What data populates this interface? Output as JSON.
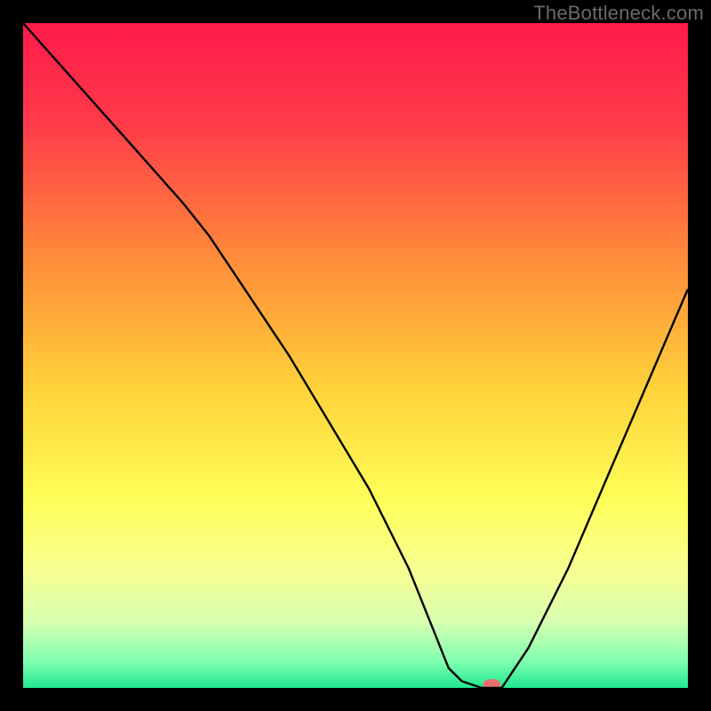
{
  "watermark": "TheBottleneck.com",
  "chart_data": {
    "type": "line",
    "title": "",
    "xlabel": "",
    "ylabel": "",
    "xlim": [
      0,
      100
    ],
    "ylim": [
      0,
      100
    ],
    "grid": false,
    "legend": false,
    "background_gradient": {
      "stops": [
        {
          "offset": 0.0,
          "color": "#ff1a4a"
        },
        {
          "offset": 0.15,
          "color": "#ff3a4a"
        },
        {
          "offset": 0.35,
          "color": "#ff8a3a"
        },
        {
          "offset": 0.55,
          "color": "#ffd23a"
        },
        {
          "offset": 0.72,
          "color": "#ffff5a"
        },
        {
          "offset": 0.82,
          "color": "#f8ff90"
        },
        {
          "offset": 0.9,
          "color": "#d8ffb0"
        },
        {
          "offset": 0.96,
          "color": "#80ffb0"
        },
        {
          "offset": 1.0,
          "color": "#20e890"
        }
      ]
    },
    "series": [
      {
        "name": "bottleneck-curve",
        "color": "#000000",
        "x": [
          0,
          8,
          16,
          24,
          28,
          34,
          40,
          46,
          52,
          58,
          62,
          64,
          66,
          69,
          72,
          76,
          82,
          88,
          94,
          100
        ],
        "y": [
          100,
          91,
          82,
          73,
          68,
          59,
          50,
          40,
          30,
          18,
          8,
          3,
          1,
          0,
          0,
          6,
          18,
          32,
          46,
          60
        ]
      }
    ],
    "marker": {
      "name": "optimal-point",
      "x": 70.5,
      "y": 0,
      "color": "#e97070",
      "rx": 10,
      "ry": 6
    }
  }
}
